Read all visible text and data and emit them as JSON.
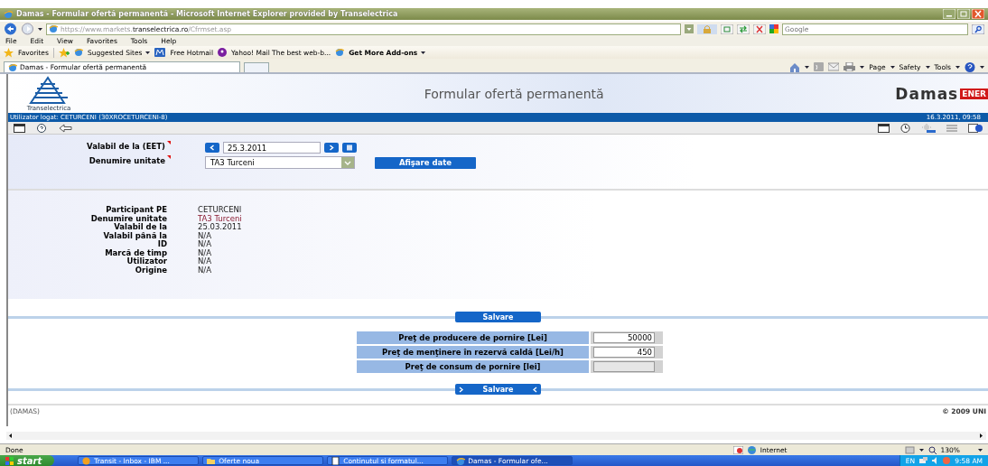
{
  "window": {
    "title": "Damas - Formular ofertă permanentă - Microsoft Internet Explorer provided by Transelectrica"
  },
  "address_bar": {
    "url_parts": [
      {
        "text": "https://www.markets.",
        "emphasis": false
      },
      {
        "text": "transelectrica.ro",
        "emphasis": true
      },
      {
        "text": "/Cfrmset.asp",
        "emphasis": false
      }
    ]
  },
  "search": {
    "placeholder": "Google"
  },
  "menu": [
    "File",
    "Edit",
    "View",
    "Favorites",
    "Tools",
    "Help"
  ],
  "favorites_bar": {
    "label": "Favorites",
    "links": [
      {
        "label": "Suggested Sites",
        "kind": "ie",
        "dropdown": true,
        "bold": false
      },
      {
        "label": "Free Hotmail",
        "kind": "hotmail",
        "dropdown": false,
        "bold": false
      },
      {
        "label": "Yahoo! Mail The best web-b...",
        "kind": "yahoo",
        "dropdown": false,
        "bold": false
      },
      {
        "label": "Get More Add-ons",
        "kind": "ie",
        "dropdown": true,
        "bold": true
      }
    ]
  },
  "tabs": [
    {
      "label": "Damas - Formular ofertă permanentă",
      "selected": true
    }
  ],
  "command_bar": [
    "Page",
    "Safety",
    "Tools"
  ],
  "page": {
    "logo_caption": "Transelectrica",
    "title": "Formular ofertă permanentă",
    "brand": "Damas",
    "brand_suffix": "ENER",
    "user": "Utilizator logat: CETURCENI (30XROCETURCENI-8)",
    "datetime": "16.3.2011, 09:58",
    "filter": {
      "date_label": "Valabil de la (EET)",
      "date_required": true,
      "date_value": "25.3.2011",
      "unit_label": "Denumire unitate",
      "unit_required": true,
      "unit_value": "TA3 Turceni",
      "button": "Afişare date"
    },
    "info": [
      {
        "label": "Participant PE",
        "value": "CETURCENI"
      },
      {
        "label": "Denumire unitate",
        "value": "TA3 Turceni"
      },
      {
        "label": "Valabil de la",
        "value": "25.03.2011"
      },
      {
        "label": "Valabil până la",
        "value": "N/A"
      },
      {
        "label": "ID",
        "value": "N/A"
      },
      {
        "label": "Marcă de timp",
        "value": "N/A"
      },
      {
        "label": "Utilizator",
        "value": "N/A"
      },
      {
        "label": "Origine",
        "value": "N/A"
      }
    ],
    "save_top": "Salvare",
    "prices": [
      {
        "label": "Preţ de producere de pornire [Lei]",
        "value": "50000",
        "disabled": false
      },
      {
        "label": "Preţ de menţinere în rezervă caldă [Lei/h]",
        "value": "450",
        "disabled": false
      },
      {
        "label": "Preţ de consum de pornire [lei]",
        "disabled": true
      }
    ],
    "save_bottom": "Salvare",
    "footer_left": "(DAMAS)",
    "footer_right": "© 2009 UNI"
  },
  "status_bar": {
    "text": "Done",
    "zone": "Internet",
    "zoom": "130%"
  },
  "taskbar": {
    "start": "start",
    "items": [
      {
        "label": "Transit - Inbox - IBM ...",
        "kind": "notes",
        "selected": false
      },
      {
        "label": "Oferte noua",
        "kind": "folder",
        "selected": false
      },
      {
        "label": "Continutul si formatul...",
        "kind": "doc",
        "selected": false
      },
      {
        "label": "Damas - Formular ofe...",
        "kind": "ie",
        "selected": true
      }
    ],
    "language": "EN",
    "time": "9:58 AM"
  }
}
